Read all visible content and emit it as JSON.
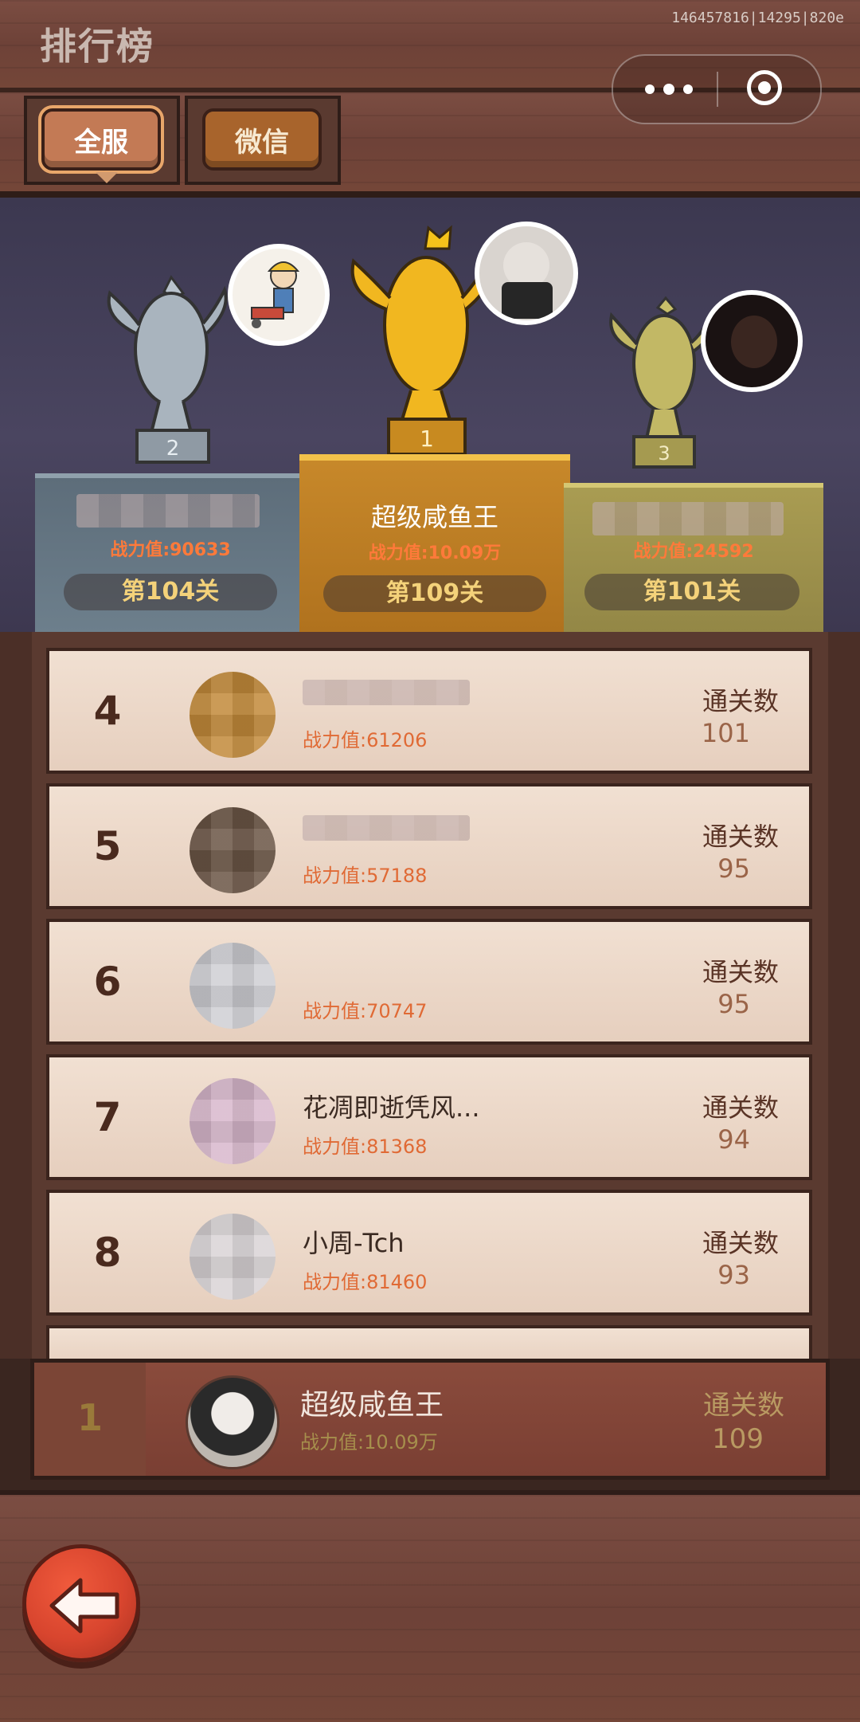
{
  "header": {
    "title": "排行榜",
    "debug": "146457816|14295|820e"
  },
  "tabs": [
    {
      "label": "全服",
      "active": true
    },
    {
      "label": "微信",
      "active": false
    }
  ],
  "podium": {
    "second": {
      "power": "战力值:90633",
      "level": "第104关"
    },
    "first": {
      "name": "超级咸鱼王",
      "power": "战力值:10.09万",
      "level": "第109关"
    },
    "third": {
      "power": "战力值:24592",
      "level": "第101关"
    }
  },
  "list": {
    "clear_label": "通关数",
    "rows": [
      {
        "rank": "4",
        "name": "",
        "power": "战力值:61206",
        "cleared": "101"
      },
      {
        "rank": "5",
        "name": "",
        "power": "战力值:57188",
        "cleared": "95"
      },
      {
        "rank": "6",
        "name": "",
        "power": "战力值:70747",
        "cleared": "95"
      },
      {
        "rank": "7",
        "name": "花凋即逝凭风...",
        "power": "战力值:81368",
        "cleared": "94"
      },
      {
        "rank": "8",
        "name": "小周-Tch",
        "power": "战力值:81460",
        "cleared": "93"
      }
    ]
  },
  "my_rank": {
    "rank": "1",
    "name": "超级咸鱼王",
    "power": "战力值:10.09万",
    "clear_label": "通关数",
    "cleared": "109"
  },
  "colors": {
    "gold": "#f4d27a",
    "power_orange": "#e06a35",
    "wood": "#6e4238"
  },
  "icons": {
    "back": "back-arrow-icon",
    "more": "more-dots-icon",
    "close": "close-target-icon"
  }
}
